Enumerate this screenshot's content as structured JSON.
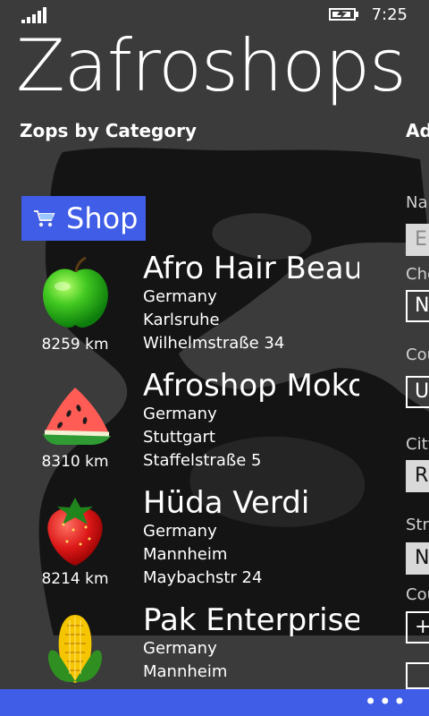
{
  "status_bar": {
    "time": "7:25",
    "signal_icon": "signal-icon",
    "battery_icon": "battery-charging-icon"
  },
  "app": {
    "title": "Zafroshops"
  },
  "headers": {
    "left_section": "Zops by Category",
    "right_section": "Ad"
  },
  "category": {
    "icon": "shopping-cart-icon",
    "label": "Shop",
    "accent": "#3F5DE6"
  },
  "shops": [
    {
      "icon": "green-apple-icon",
      "distance": "8259 km",
      "name": "Afro Hair Beauty",
      "country": "Germany",
      "city": "Karlsruhe",
      "street": "Wilhelmstraße 34"
    },
    {
      "icon": "watermelon-slice-icon",
      "distance": "8310 km",
      "name": "Afroshop Moko",
      "country": "Germany",
      "city": "Stuttgart",
      "street": "Staffelstraße 5"
    },
    {
      "icon": "strawberry-icon",
      "distance": "8214 km",
      "name": "Hüda Verdi",
      "country": "Germany",
      "city": "Mannheim",
      "street": "Maybachstr 24"
    },
    {
      "icon": "corn-icon",
      "distance": "",
      "name": "Pak Enterprises",
      "country": "Germany",
      "city": "Mannheim",
      "street": ""
    }
  ],
  "form": {
    "name_label": "Na",
    "name_value": "E",
    "choice_label": "Che",
    "choice_value": "N",
    "country_label": "Cou",
    "country_value": "U",
    "city_label": "City",
    "city_value": "R",
    "street_label": "Stre",
    "street_value": "N",
    "count_label": "Cou",
    "count_value": "+"
  },
  "app_bar": {
    "more_label": "•••",
    "accent": "#3F5DE6"
  }
}
